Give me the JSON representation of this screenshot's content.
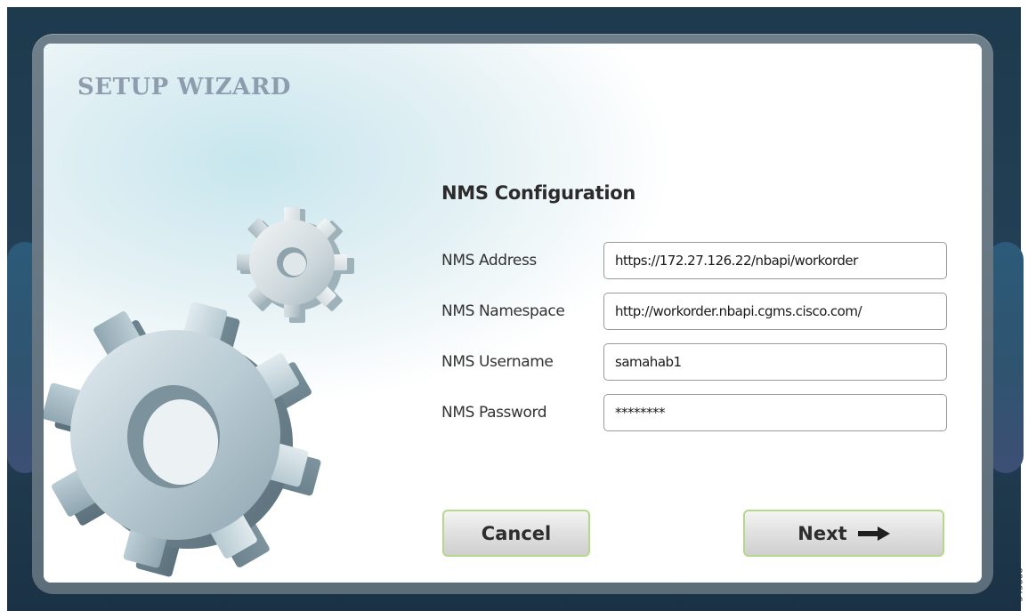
{
  "wizard": {
    "title": "SETUP WIZARD"
  },
  "form": {
    "title": "NMS Configuration",
    "fields": [
      {
        "label": "NMS Address",
        "value": "https://172.27.126.22/nbapi/workorder"
      },
      {
        "label": "NMS Namespace",
        "value": "http://workorder.nbapi.cgms.cisco.com/"
      },
      {
        "label": "NMS Username",
        "value": "samahab1"
      },
      {
        "label": "NMS Password",
        "value": "********"
      }
    ]
  },
  "buttons": {
    "cancel_label": "Cancel",
    "next_label": "Next"
  },
  "figure_id": "345888",
  "colors": {
    "backdrop": "#213d52",
    "frame": "#66757f",
    "title_text": "#8e9dae",
    "button_border": "#b6d88a"
  },
  "icons": {
    "illustration": "gears-icon",
    "next": "arrow-right-icon"
  }
}
